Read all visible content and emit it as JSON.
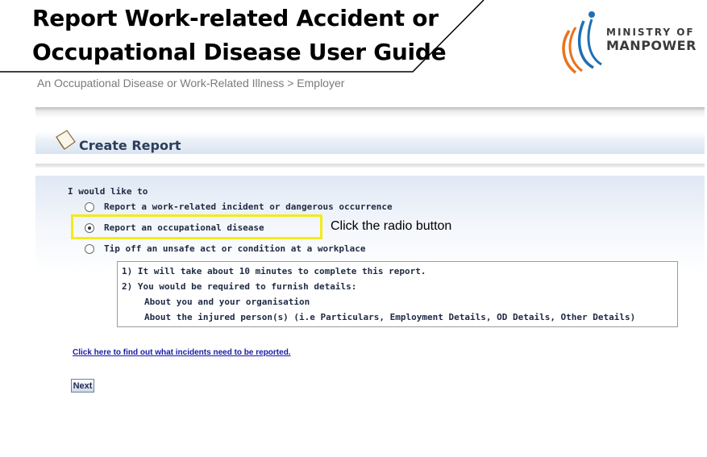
{
  "slide": {
    "title_line1": "Report Work-related Accident or",
    "title_line2": "Occupational Disease User Guide",
    "breadcrumb": "An Occupational Disease or Work-Related Illness > Employer",
    "logo": {
      "line1": "MINISTRY OF",
      "line2": "MANPOWER"
    },
    "callout": "Click the radio button",
    "highlight_color": "#f1ec1a"
  },
  "form": {
    "header_title": "Create Report",
    "prompt": "I would like to",
    "options": [
      {
        "label": "Report a work-related incident or dangerous occurrence",
        "checked": false
      },
      {
        "label": "Report an occupational disease",
        "checked": true
      },
      {
        "label": "Tip off an unsafe act or condition at a workplace",
        "checked": false
      }
    ],
    "info": [
      "1) It will take about 10 minutes to complete this report.",
      "2) You would be required to furnish details:",
      "About you and your organisation",
      "About the injured person(s) (i.e Particulars, Employment Details, OD Details, Other Details)"
    ],
    "link_text": "Click here to find out what incidents need to be reported.",
    "next_label": "Next"
  },
  "colors": {
    "header_text": "#2c3e5a",
    "link": "#1a1aa6",
    "logo_orange": "#e8731f",
    "logo_blue": "#1f6fb4"
  },
  "icons": [
    "document-icon",
    "ministry-logo-icon"
  ]
}
